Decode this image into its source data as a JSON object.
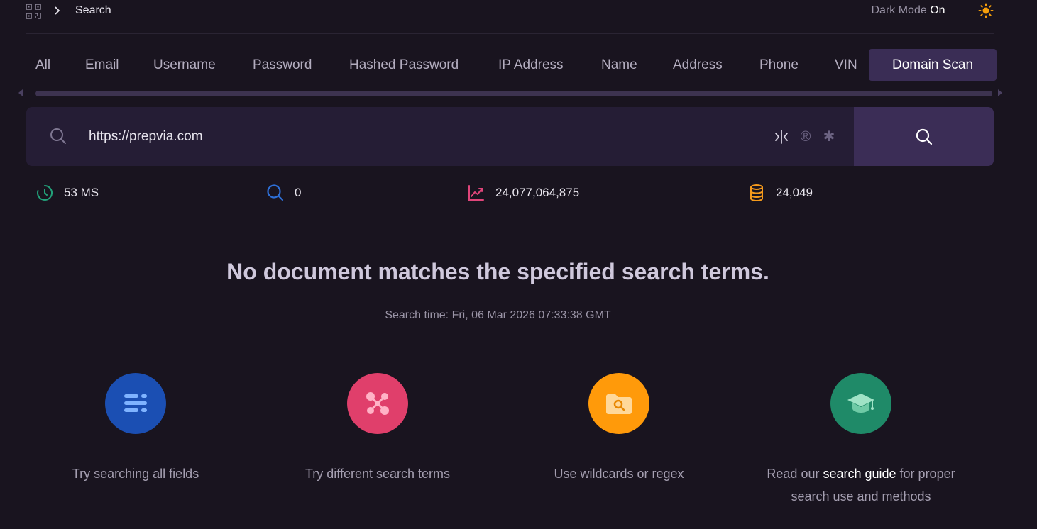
{
  "breadcrumb": {
    "current": "Search"
  },
  "theme": {
    "label": "Dark Mode",
    "state": "On"
  },
  "tabs": [
    {
      "label": "All"
    },
    {
      "label": "Email"
    },
    {
      "label": "Username"
    },
    {
      "label": "Password"
    },
    {
      "label": "Hashed Password"
    },
    {
      "label": "IP Address"
    },
    {
      "label": "Name"
    },
    {
      "label": "Address"
    },
    {
      "label": "Phone"
    },
    {
      "label": "VIN"
    },
    {
      "label": "Domain Scan"
    }
  ],
  "active_tab": "Domain Scan",
  "search": {
    "value": "https://prepvia.com",
    "placeholder": ""
  },
  "stats": {
    "time": "53 MS",
    "results": "0",
    "total_records": "24,077,064,875",
    "databases": "24,049"
  },
  "message": {
    "headline": "No document matches the specified search terms.",
    "search_time": "Search time: Fri, 06 Mar 2026 07:33:38 GMT"
  },
  "tips": [
    {
      "text": "Try searching all fields",
      "color": "#1b4fb3"
    },
    {
      "text": "Try different search terms",
      "color": "#e03f6b"
    },
    {
      "text": "Use wildcards or regex",
      "color": "#ff9a0a"
    },
    {
      "pre": "Read our ",
      "link": "search guide",
      "post": " for proper search use and methods",
      "color": "#1f8a68"
    }
  ],
  "colors": {
    "accent": "#3a2d55",
    "background": "#19141f"
  }
}
